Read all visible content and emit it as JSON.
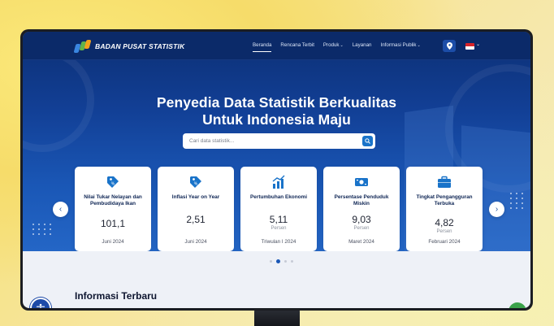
{
  "header": {
    "logo_text": "BADAN PUSAT STATISTIK",
    "nav": [
      {
        "label": "Beranda",
        "dropdown": false,
        "active": true
      },
      {
        "label": "Rencana Terbit",
        "dropdown": false,
        "active": false
      },
      {
        "label": "Produk",
        "dropdown": true,
        "active": false
      },
      {
        "label": "Layanan",
        "dropdown": false,
        "active": false
      },
      {
        "label": "Informasi Publik",
        "dropdown": true,
        "active": false
      }
    ],
    "location_icon": "map-pin-icon",
    "language_flag": "indonesia-flag-icon"
  },
  "hero": {
    "headline_line1": "Penyedia Data Statistik Berkualitas",
    "headline_line2": "Untuk Indonesia Maju",
    "search_placeholder": "Cari data statistik...",
    "search_icon": "search-icon"
  },
  "cards": [
    {
      "icon": "price-tag-icon",
      "title": "Nilai Tukar Nelayan dan Pembudidaya Ikan",
      "value": "101,1",
      "unit": "",
      "period": "Juni 2024"
    },
    {
      "icon": "price-tag-icon",
      "title": "Inflasi Year on Year",
      "value": "2,51",
      "unit": "",
      "period": "Juni 2024"
    },
    {
      "icon": "bar-chart-icon",
      "title": "Pertumbuhan Ekonomi",
      "value": "5,11",
      "unit": "Persen",
      "period": "Triwulan I 2024"
    },
    {
      "icon": "money-icon",
      "title": "Persentase Penduduk Miskin",
      "value": "9,03",
      "unit": "Persen",
      "period": "Maret 2024"
    },
    {
      "icon": "briefcase-icon",
      "title": "Tingkat Pengangguran Terbuka",
      "value": "4,82",
      "unit": "Persen",
      "period": "Februari 2024"
    }
  ],
  "carousel": {
    "pages": 4,
    "active_page": 2
  },
  "section": {
    "title": "Informasi Terbaru"
  },
  "colors": {
    "primary": "#1a57b6",
    "navbar": "#0b2a69",
    "accent": "#1973c9"
  }
}
